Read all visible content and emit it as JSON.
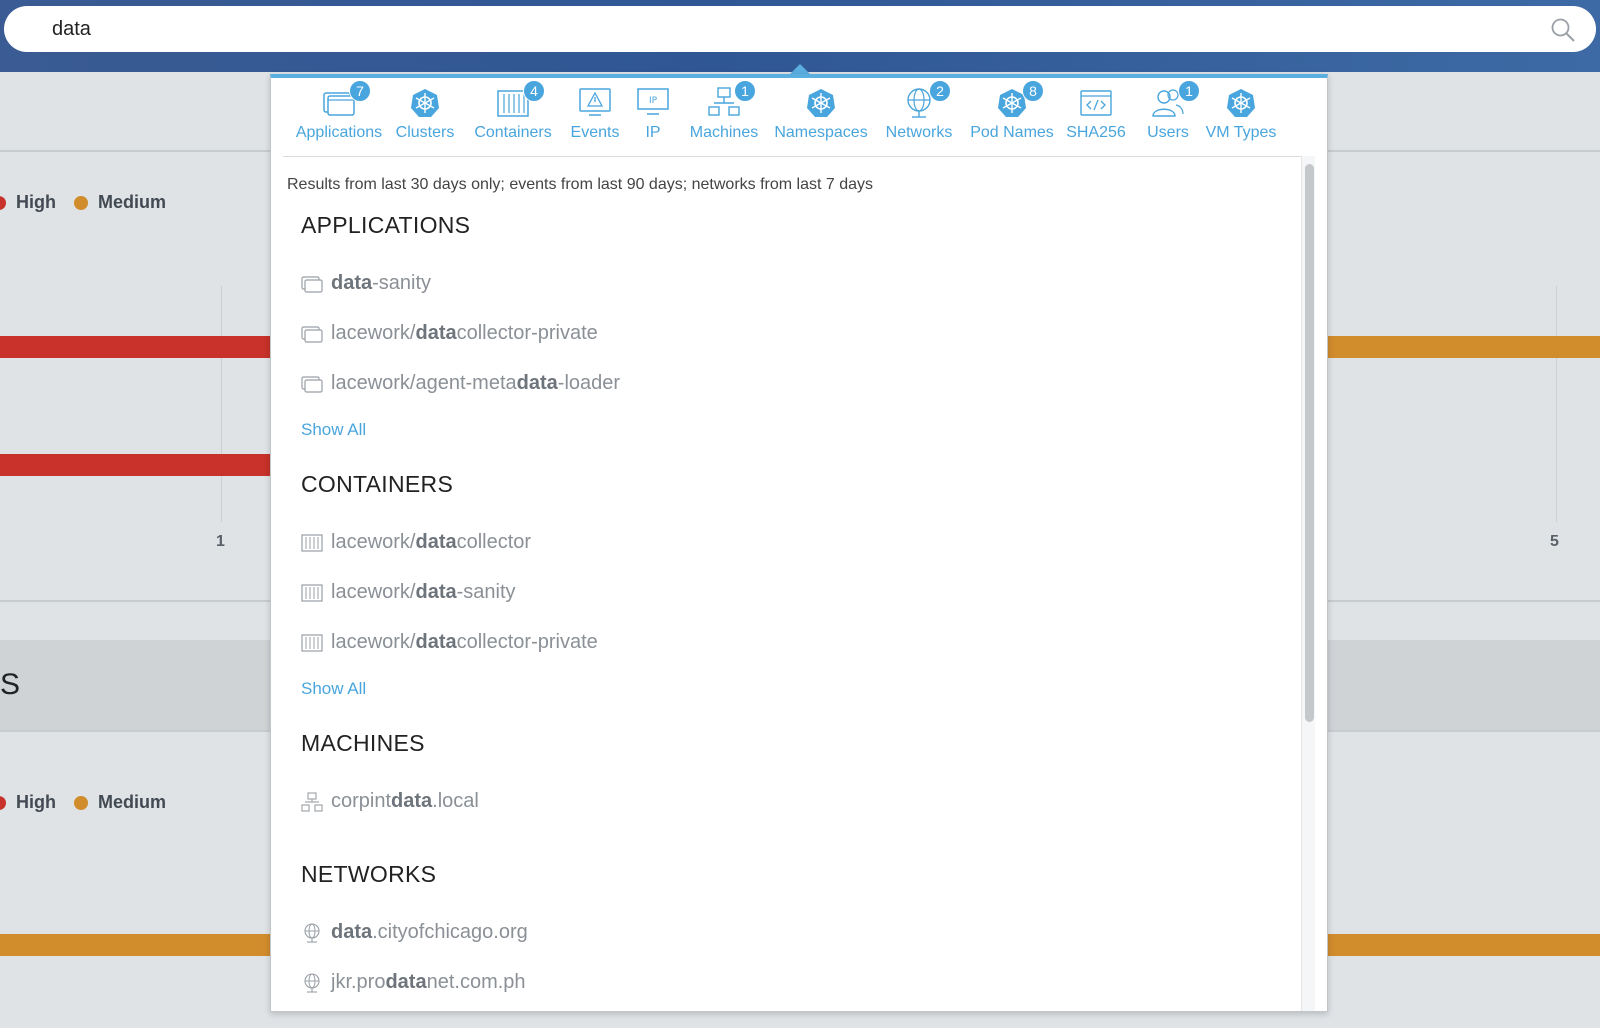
{
  "search": {
    "value": "data"
  },
  "background": {
    "legend_top": [
      {
        "label": "High",
        "color": "#c8322b"
      },
      {
        "label": "Medium",
        "color": "#d18c2c"
      }
    ],
    "legend_bottom": [
      {
        "label": "High",
        "color": "#c8322b"
      },
      {
        "label": "Medium",
        "color": "#d18c2c"
      }
    ],
    "axis_ticks": [
      "1",
      "5"
    ],
    "section_title_fragment": "S"
  },
  "tabs": [
    {
      "label": "Applications",
      "icon": "application-icon",
      "count": "7"
    },
    {
      "label": "Clusters",
      "icon": "kubernetes-icon",
      "count": ""
    },
    {
      "label": "Containers",
      "icon": "container-icon",
      "count": "4"
    },
    {
      "label": "Events",
      "icon": "event-warning-icon",
      "count": ""
    },
    {
      "label": "IP",
      "icon": "ip-icon",
      "count": ""
    },
    {
      "label": "Machines",
      "icon": "machine-network-icon",
      "count": "1"
    },
    {
      "label": "Namespaces",
      "icon": "kubernetes-icon",
      "count": ""
    },
    {
      "label": "Networks",
      "icon": "globe-icon",
      "count": "2"
    },
    {
      "label": "Pod Names",
      "icon": "kubernetes-icon",
      "count": "8"
    },
    {
      "label": "SHA256",
      "icon": "code-window-icon",
      "count": ""
    },
    {
      "label": "Users",
      "icon": "users-icon",
      "count": "1"
    },
    {
      "label": "VM Types",
      "icon": "kubernetes-icon",
      "count": ""
    }
  ],
  "note": "Results from last 30 days only; events from last 90 days; networks from last 7 days",
  "groups": {
    "applications": {
      "title": "APPLICATIONS",
      "items": [
        {
          "pre": "",
          "match": "data",
          "post": "-sanity"
        },
        {
          "pre": "lacework/",
          "match": "data",
          "post": "collector-private"
        },
        {
          "pre": "lacework/agent-meta",
          "match": "data",
          "post": "-loader"
        }
      ],
      "show_all": "Show All"
    },
    "containers": {
      "title": "CONTAINERS",
      "items": [
        {
          "pre": "lacework/",
          "match": "data",
          "post": "collector"
        },
        {
          "pre": "lacework/",
          "match": "data",
          "post": "-sanity"
        },
        {
          "pre": "lacework/",
          "match": "data",
          "post": "collector-private"
        }
      ],
      "show_all": "Show All"
    },
    "machines": {
      "title": "MACHINES",
      "items": [
        {
          "pre": "corpint",
          "match": "data",
          "post": ".local"
        }
      ]
    },
    "networks": {
      "title": "NETWORKS",
      "items": [
        {
          "pre": "",
          "match": "data",
          "post": ".cityofchicago.org"
        },
        {
          "pre": "jkr.pro",
          "match": "data",
          "post": "net.com.ph"
        }
      ]
    }
  }
}
